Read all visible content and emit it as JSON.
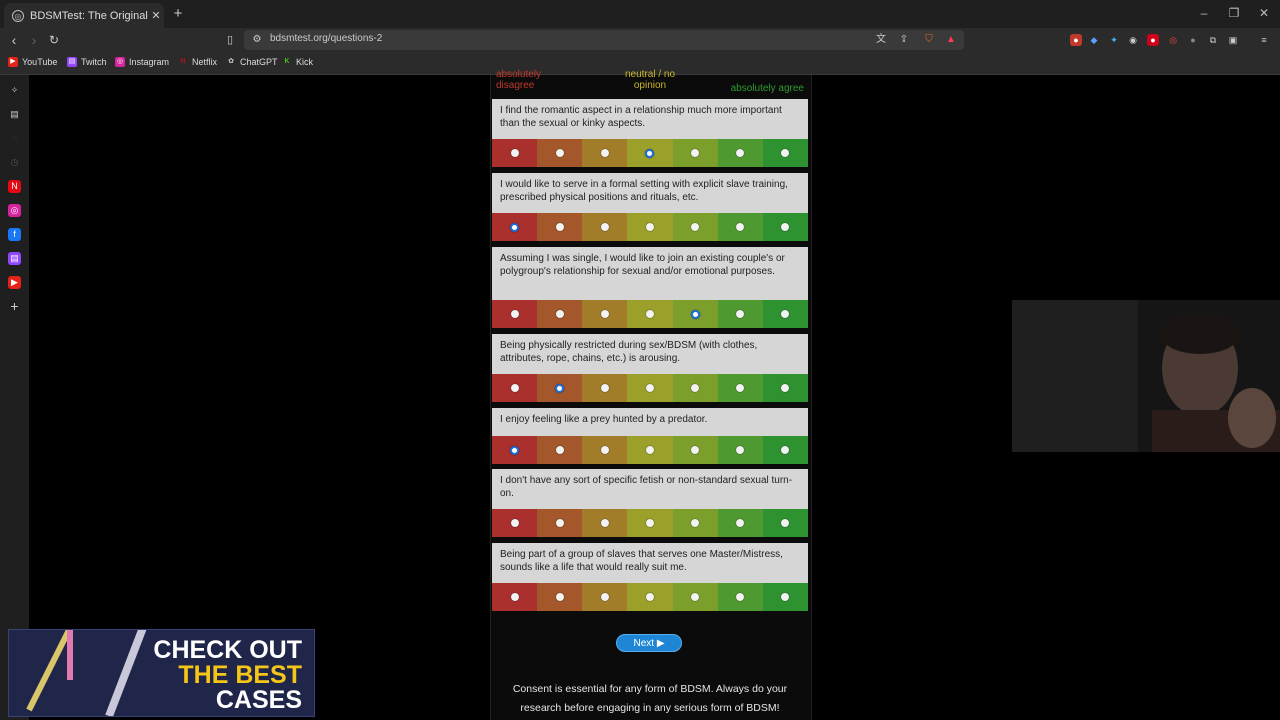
{
  "browser": {
    "tab_title": "BDSMTest: The Original BDSM &",
    "url": "bdsmtest.org/questions-2",
    "bookmarks": [
      {
        "label": "YouTube",
        "color": "#e62117"
      },
      {
        "label": "Twitch",
        "color": "#9146ff"
      },
      {
        "label": "Instagram",
        "color": "#d6249f"
      },
      {
        "label": "Netflix",
        "color": "#e50914"
      },
      {
        "label": "ChatGPT",
        "color": "#888888"
      },
      {
        "label": "Kick",
        "color": "#53fc18"
      }
    ]
  },
  "scale": {
    "left": "absolutely disagree",
    "middle": "neutral / no opinion",
    "right": "absolutely agree"
  },
  "questions": [
    {
      "text": "I find the romantic aspect in a relationship much more important than the sexual or kinky aspects.",
      "selected": 3
    },
    {
      "text": "I would like to serve in a formal setting with explicit slave training, prescribed physical positions and rituals, etc.",
      "selected": 0
    },
    {
      "text": "Assuming I was single, I would like to join an existing couple's or polygroup's relationship for sexual and/or emotional purposes.",
      "selected": 4
    },
    {
      "text": "Being physically restricted during sex/BDSM (with clothes, attributes, rope, chains, etc.) is arousing.",
      "selected": 1
    },
    {
      "text": "I enjoy feeling like a prey hunted by a predator.",
      "selected": 0
    },
    {
      "text": "I don't have any sort of specific fetish or non-standard sexual turn-on.",
      "selected": -1
    },
    {
      "text": "Being part of a group of slaves that serves one Master/Mistress, sounds like a life that would really suit me.",
      "selected": -1
    }
  ],
  "next_button": "Next ▶",
  "footer": "Consent is essential for any form of BDSM. Always do your research before engaging in any serious form of BDSM!",
  "ad": {
    "line1": "CHECK OUT",
    "line2": "THE BEST",
    "line3": "CASES"
  }
}
